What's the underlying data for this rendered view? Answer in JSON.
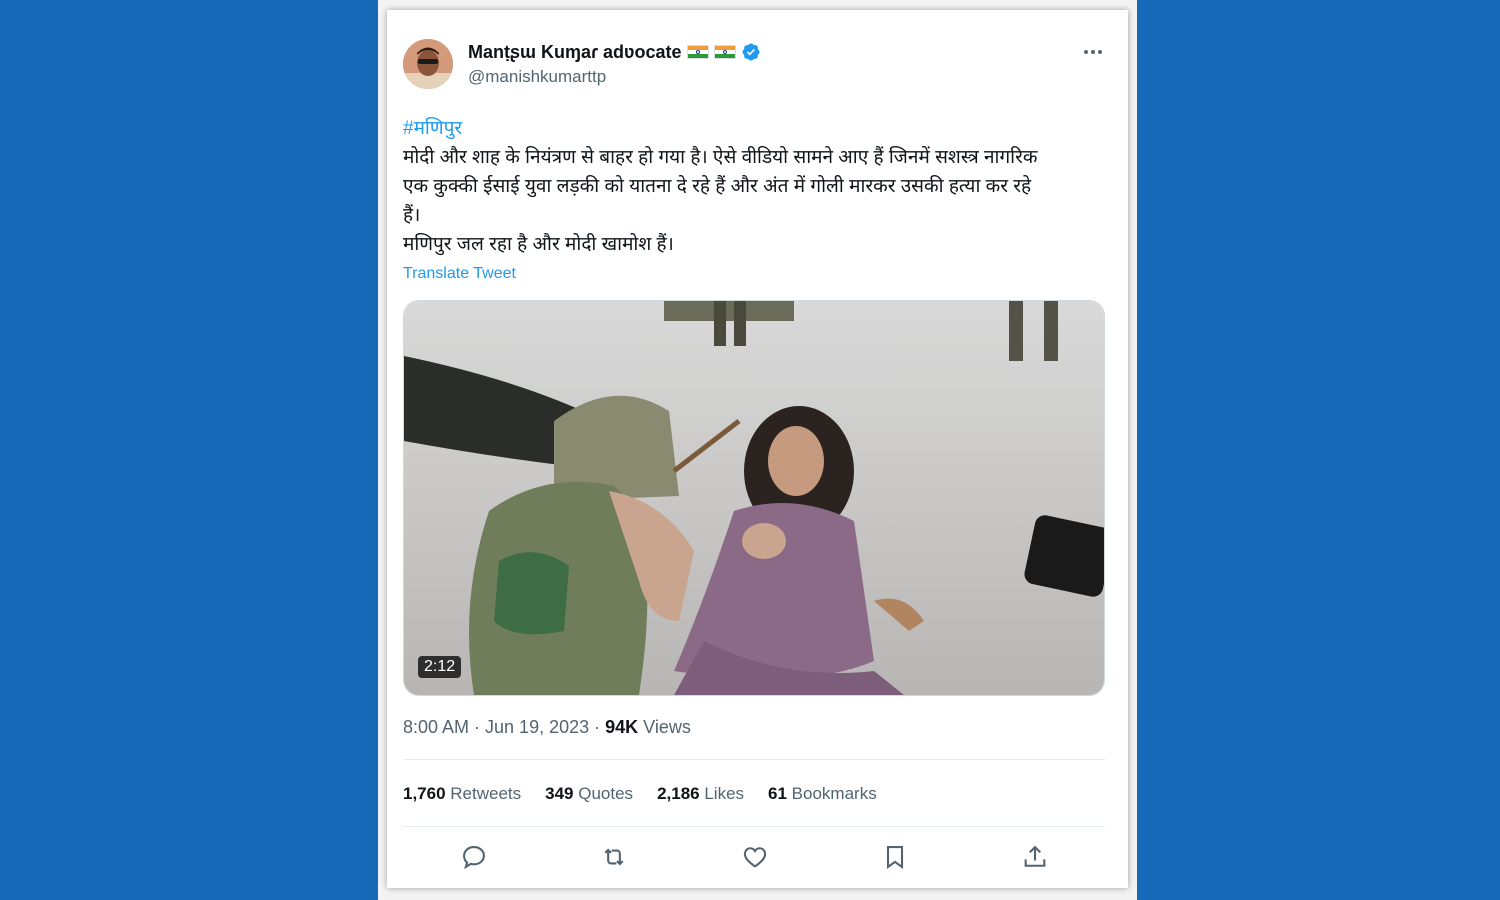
{
  "tweet": {
    "display_name": "Manṭʂɯ Kuɱaɾ adʋocate",
    "handle": "@manishkumarttp",
    "hashtag": "#मणिपुर",
    "text_lines": [
      "मोदी और शाह के नियंत्रण से बाहर हो गया है।  ऐसे वीडियो सामने आए हैं जिनमें सशस्त्र नागरिक",
      "एक कुक्की ईसाई युवा लड़की को यातना दे रहे हैं और अंत में गोली मारकर उसकी हत्या कर रहे",
      "हैं।",
      " मणिपुर जल रहा है और मोदी खामोश हैं।"
    ],
    "translate_label": "Translate Tweet",
    "video_duration": "2:12",
    "time": "8:00 AM · Jun 19, 2023 · ",
    "views_count": "94K",
    "views_label": " Views",
    "stats": {
      "retweets_count": "1,760",
      "retweets_label": " Retweets",
      "quotes_count": "349",
      "quotes_label": " Quotes",
      "likes_count": "2,186",
      "likes_label": " Likes",
      "bookmarks_count": "61",
      "bookmarks_label": " Bookmarks"
    },
    "icons": [
      "verified-badge-icon",
      "more-options-icon",
      "reply-icon",
      "retweet-icon",
      "like-icon",
      "bookmark-icon",
      "share-icon"
    ],
    "colors": {
      "background": "#1769b8",
      "link": "#1d9bf0",
      "text": "#0f1419",
      "muted": "#536471"
    }
  }
}
